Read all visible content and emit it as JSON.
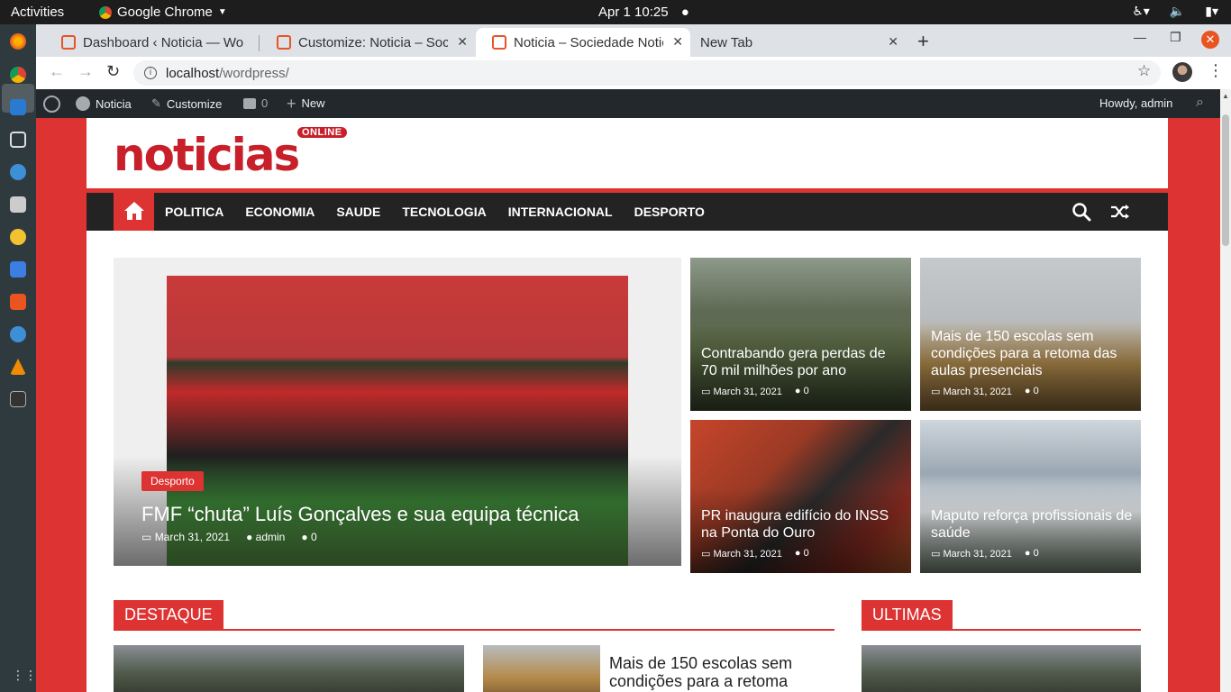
{
  "os": {
    "activities": "Activities",
    "app_name": "Google Chrome",
    "clock": "Apr 1  10:25"
  },
  "browser": {
    "tabs": [
      {
        "title": "Dashboard ‹ Noticia — Wo"
      },
      {
        "title": "Customize: Noticia – Socie"
      },
      {
        "title": "Noticia – Sociedade Notici"
      },
      {
        "title": "New Tab"
      }
    ],
    "url_host": "localhost",
    "url_path": "/wordpress/"
  },
  "adminbar": {
    "site": "Noticia",
    "customize": "Customize",
    "comments": "0",
    "new": "New",
    "howdy": "Howdy, admin"
  },
  "site": {
    "logo_text": "noticias",
    "logo_badge": "ONLINE",
    "menu": [
      "POLITICA",
      "ECONOMIA",
      "SAUDE",
      "TECNOLOGIA",
      "INTERNACIONAL",
      "DESPORTO"
    ]
  },
  "featured": {
    "category": "Desporto",
    "title": "FMF “chuta” Luís Gonçalves e sua equipa técnica",
    "date": "March 31, 2021",
    "author": "admin",
    "comments": "0"
  },
  "cards": [
    {
      "title": "Contrabando gera perdas de 70 mil milhões por ano",
      "date": "March 31, 2021",
      "comments": "0"
    },
    {
      "title": "Mais de 150 escolas sem condições para a retoma das aulas presenciais",
      "date": "March 31, 2021",
      "comments": "0"
    },
    {
      "title": "PR inaugura edifício do INSS na Ponta do Ouro",
      "date": "March 31, 2021",
      "comments": "0"
    },
    {
      "title": "Maputo reforça profissionais de saúde",
      "date": "March 31, 2021",
      "comments": "0"
    }
  ],
  "sections": {
    "destaque": "DESTAQUE",
    "ultimas": "ULTIMAS",
    "destaque_second_title": "Mais de 150 escolas sem condições para a retoma"
  }
}
